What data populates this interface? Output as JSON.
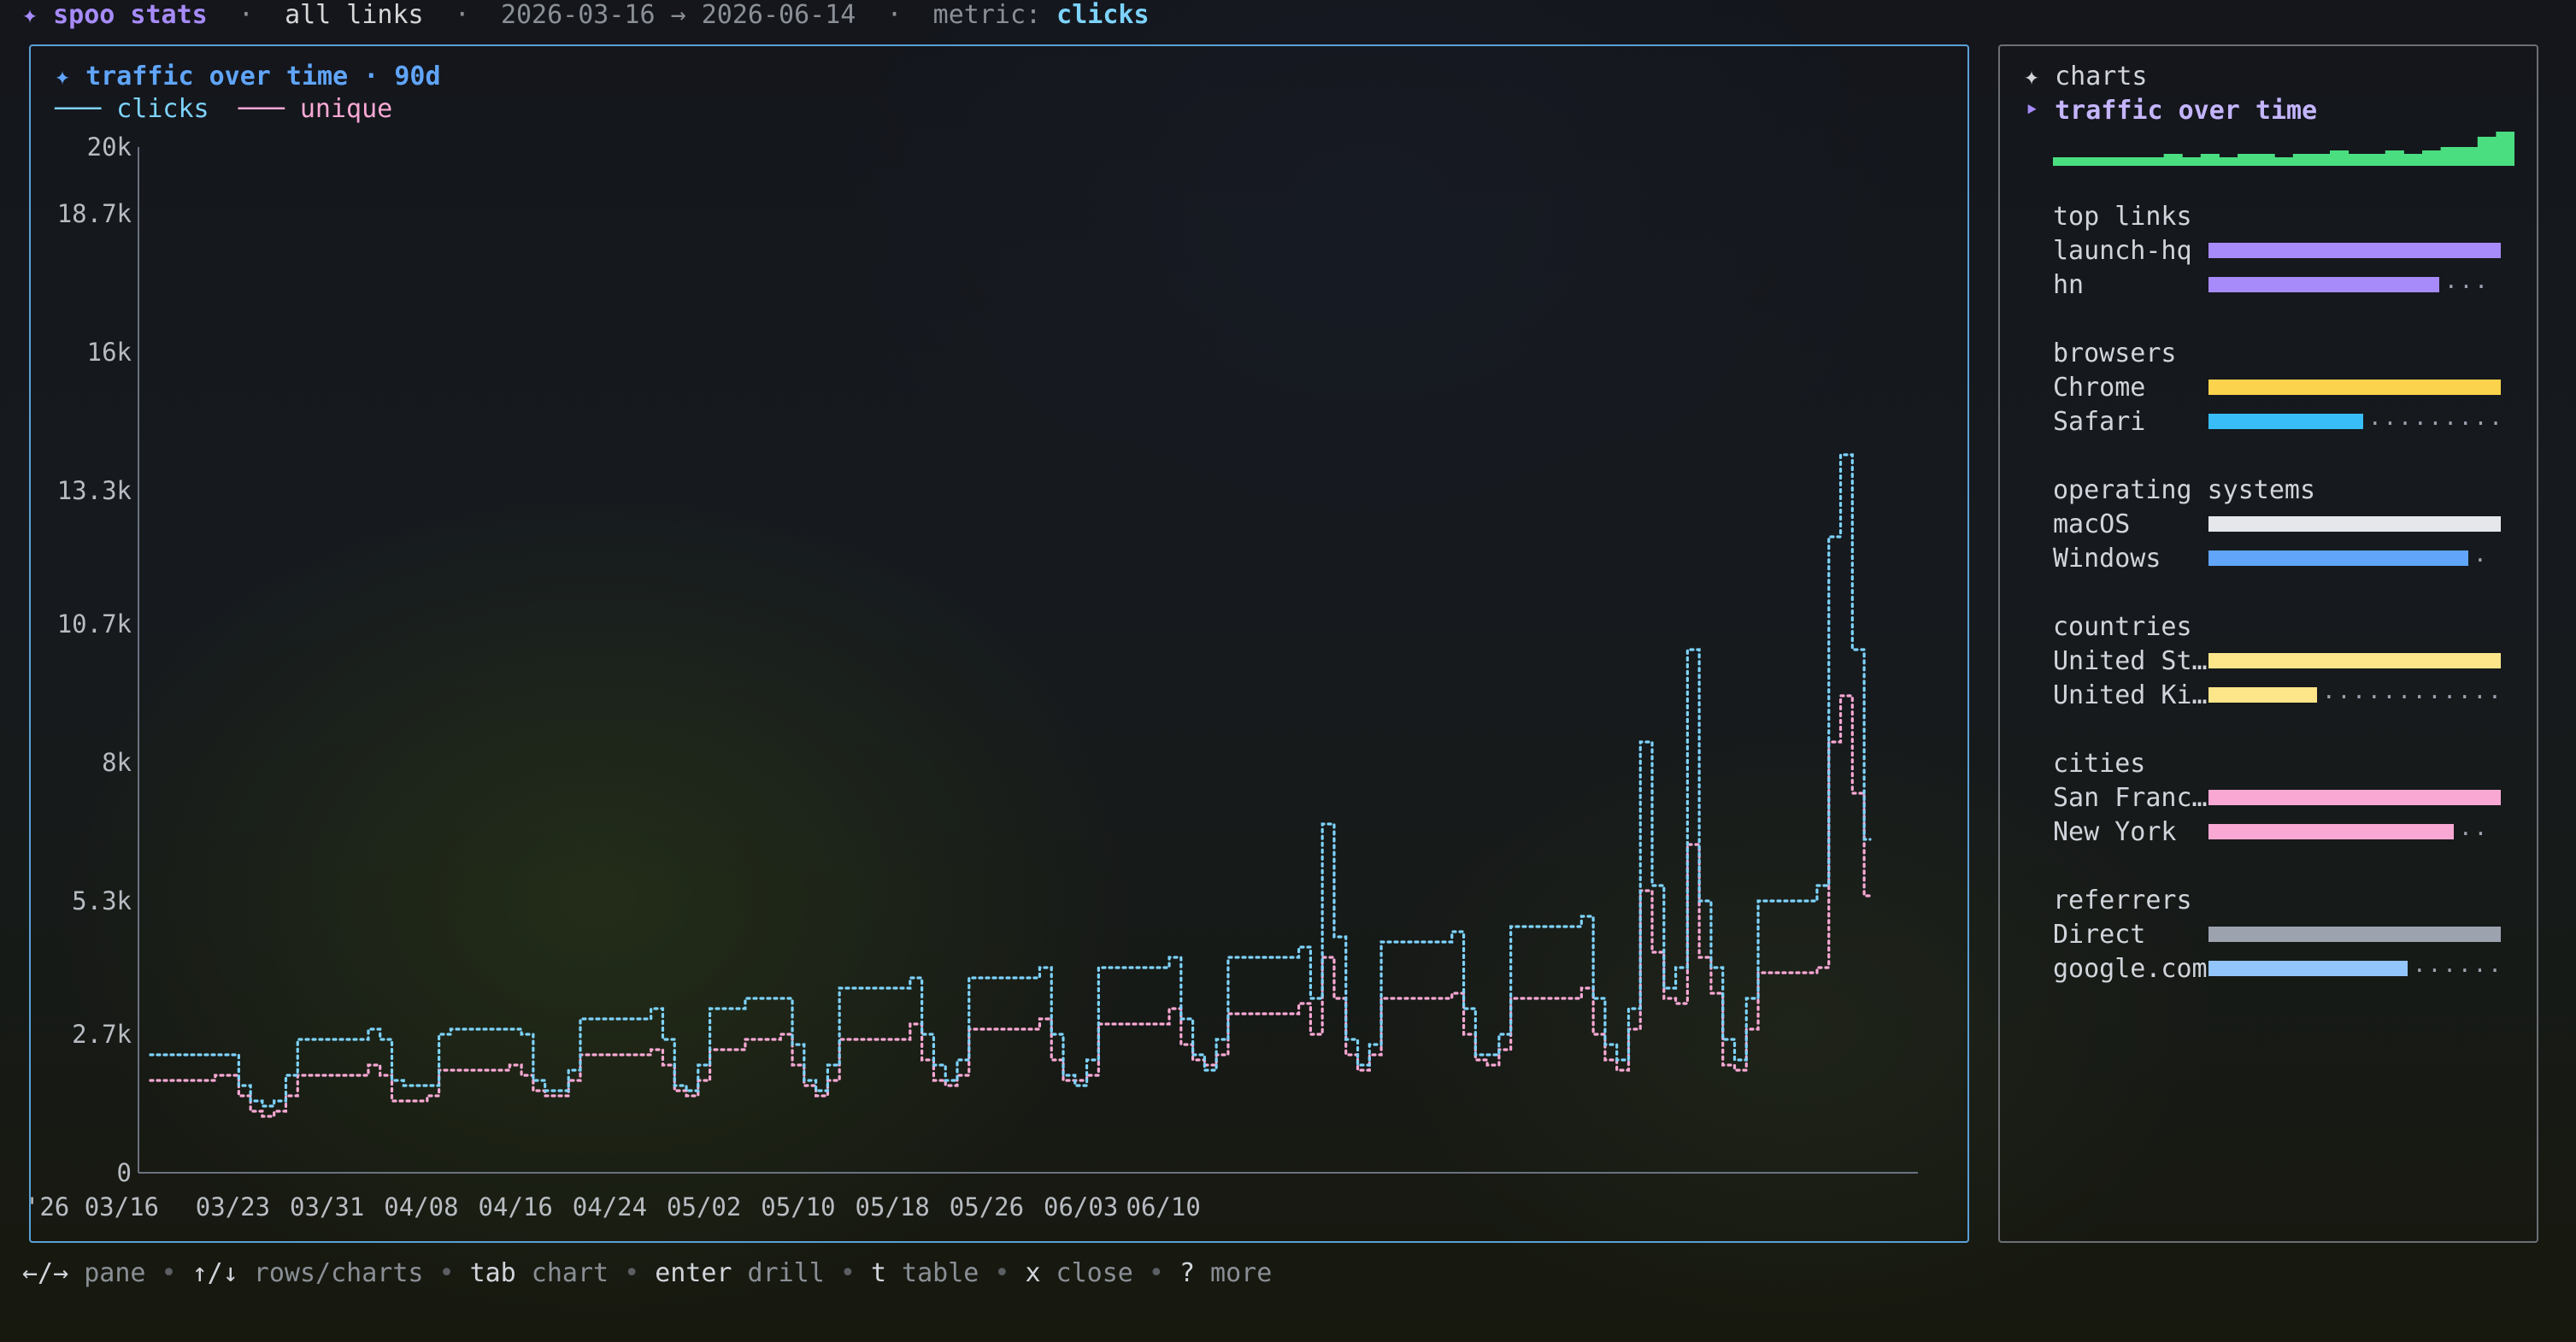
{
  "topbar": {
    "app_icon": "sparkle-icon",
    "app_name": "spoo stats",
    "scope": "all links",
    "date_range": "2026-03-16 → 2026-06-14",
    "metric_label": "metric:",
    "metric_value": "clicks"
  },
  "main": {
    "title": "✦ traffic over time · 90d",
    "legend": [
      {
        "name": "clicks",
        "color": "#7dd3fc"
      },
      {
        "name": "unique",
        "color": "#f9a8d4"
      }
    ]
  },
  "chart_data": {
    "type": "line",
    "title": "traffic over time · 90d",
    "x_tick_labels": [
      "'26 03/16",
      "03/23",
      "03/31",
      "04/08",
      "04/16",
      "04/24",
      "05/02",
      "05/10",
      "05/18",
      "05/26",
      "06/03",
      "06/10"
    ],
    "y_tick_labels": [
      "20k",
      "18.7k",
      "16k",
      "13.3k",
      "10.7k",
      "8k",
      "5.3k",
      "2.7k",
      "0"
    ],
    "y_ticks": [
      20000,
      18700,
      16000,
      13300,
      10700,
      8000,
      5300,
      2700,
      0
    ],
    "ylim": [
      0,
      20000
    ],
    "grid": false,
    "legend_position": "top-left",
    "start_date": "2026-03-16",
    "series": [
      {
        "name": "clicks",
        "color": "#7dd3fc",
        "values": [
          2300,
          2300,
          2300,
          2300,
          2300,
          2300,
          2300,
          2300,
          1700,
          1400,
          1300,
          1400,
          1900,
          2600,
          2600,
          2600,
          2600,
          2600,
          2600,
          2800,
          2600,
          1800,
          1700,
          1700,
          1700,
          2700,
          2800,
          2800,
          2800,
          2800,
          2800,
          2800,
          2700,
          1800,
          1600,
          1600,
          2000,
          3000,
          3000,
          3000,
          3000,
          3000,
          3000,
          3200,
          2600,
          1700,
          1600,
          2100,
          3200,
          3200,
          3200,
          3400,
          3400,
          3400,
          3400,
          2500,
          1800,
          1600,
          2100,
          3600,
          3600,
          3600,
          3600,
          3600,
          3600,
          3800,
          2700,
          2100,
          1800,
          2200,
          3800,
          3800,
          3800,
          3800,
          3800,
          3800,
          4000,
          2700,
          1900,
          1700,
          2200,
          4000,
          4000,
          4000,
          4000,
          4000,
          4000,
          4200,
          3000,
          2300,
          2000,
          2600,
          4200,
          4200,
          4200,
          4200,
          4200,
          4200,
          4400,
          3400,
          6800,
          4600,
          2600,
          2100,
          2500,
          4500,
          4500,
          4500,
          4500,
          4500,
          4500,
          4700,
          3200,
          2300,
          2300,
          2700,
          4800,
          4800,
          4800,
          4800,
          4800,
          4800,
          5000,
          3400,
          2500,
          2200,
          3200,
          8400,
          5600,
          3600,
          4000,
          10200,
          5300,
          4000,
          2600,
          2200,
          3400,
          5300,
          5300,
          5300,
          5300,
          5300,
          5600,
          12400,
          14000,
          10200,
          6500
        ]
      },
      {
        "name": "unique",
        "color": "#f9a8d4",
        "values": [
          1800,
          1800,
          1800,
          1800,
          1800,
          1800,
          1900,
          1900,
          1500,
          1200,
          1100,
          1200,
          1500,
          1900,
          1900,
          1900,
          1900,
          1900,
          1900,
          2100,
          1900,
          1400,
          1400,
          1400,
          1500,
          2000,
          2000,
          2000,
          2000,
          2000,
          2000,
          2100,
          1900,
          1600,
          1500,
          1500,
          1800,
          2300,
          2300,
          2300,
          2300,
          2300,
          2300,
          2400,
          2100,
          1600,
          1500,
          1800,
          2400,
          2400,
          2400,
          2600,
          2600,
          2600,
          2700,
          2100,
          1700,
          1500,
          1800,
          2600,
          2600,
          2600,
          2600,
          2600,
          2600,
          2900,
          2200,
          1800,
          1700,
          1900,
          2800,
          2800,
          2800,
          2800,
          2800,
          2800,
          3000,
          2200,
          1800,
          1800,
          1900,
          2900,
          2900,
          2900,
          2900,
          2900,
          2900,
          3200,
          2500,
          2200,
          2100,
          2300,
          3100,
          3100,
          3100,
          3100,
          3100,
          3100,
          3300,
          2700,
          4200,
          3400,
          2300,
          2000,
          2300,
          3400,
          3400,
          3400,
          3400,
          3400,
          3400,
          3500,
          2700,
          2200,
          2100,
          2400,
          3400,
          3400,
          3400,
          3400,
          3400,
          3400,
          3600,
          2700,
          2200,
          2000,
          2800,
          5500,
          4300,
          3400,
          3300,
          6400,
          4200,
          3500,
          2100,
          2000,
          2800,
          3900,
          3900,
          3900,
          3900,
          3900,
          4000,
          8400,
          9300,
          7400,
          5400
        ]
      }
    ]
  },
  "sidebar": {
    "header": "✦ charts",
    "active_chart": "traffic over time",
    "spark": [
      0.25,
      0.25,
      0.25,
      0.25,
      0.25,
      0.25,
      0.35,
      0.25,
      0.35,
      0.25,
      0.35,
      0.35,
      0.25,
      0.35,
      0.35,
      0.45,
      0.35,
      0.35,
      0.45,
      0.35,
      0.45,
      0.55,
      0.55,
      0.85,
      1.0
    ],
    "spark_color": "#4ade80",
    "sections": [
      {
        "title": "top links",
        "color": "#a78bfa",
        "rows": [
          {
            "label": "launch-hq",
            "value": 1.0
          },
          {
            "label": "hn",
            "value": 0.79
          }
        ]
      },
      {
        "title": "browsers",
        "color_a": "#fcd34d",
        "color_b": "#38bdf8",
        "rows": [
          {
            "label": "Chrome",
            "value": 1.0
          },
          {
            "label": "Safari",
            "value": 0.53
          }
        ]
      },
      {
        "title": "operating systems",
        "color_a": "#e5e7eb",
        "color_b": "#60a5fa",
        "rows": [
          {
            "label": "macOS",
            "value": 1.0
          },
          {
            "label": "Windows",
            "value": 0.89
          }
        ]
      },
      {
        "title": "countries",
        "color": "#fde68a",
        "rows": [
          {
            "label": "United St…",
            "value": 1.0
          },
          {
            "label": "United Ki…",
            "value": 0.37
          }
        ]
      },
      {
        "title": "cities",
        "color": "#f9a8d4",
        "rows": [
          {
            "label": "San Franc…",
            "value": 1.0
          },
          {
            "label": "New York",
            "value": 0.84
          }
        ]
      },
      {
        "title": "referrers",
        "color_a": "#9ca3af",
        "color_b": "#93c5fd",
        "rows": [
          {
            "label": "Direct",
            "value": 1.0
          },
          {
            "label": "google.com",
            "value": 0.68
          }
        ]
      }
    ]
  },
  "footer": {
    "hints": [
      {
        "key": "←/→",
        "action": "pane"
      },
      {
        "key": "↑/↓",
        "action": "rows/charts"
      },
      {
        "key": "tab",
        "action": "chart"
      },
      {
        "key": "enter",
        "action": "drill"
      },
      {
        "key": "t",
        "action": "table"
      },
      {
        "key": "x",
        "action": "close"
      },
      {
        "key": "?",
        "action": "more"
      }
    ]
  }
}
